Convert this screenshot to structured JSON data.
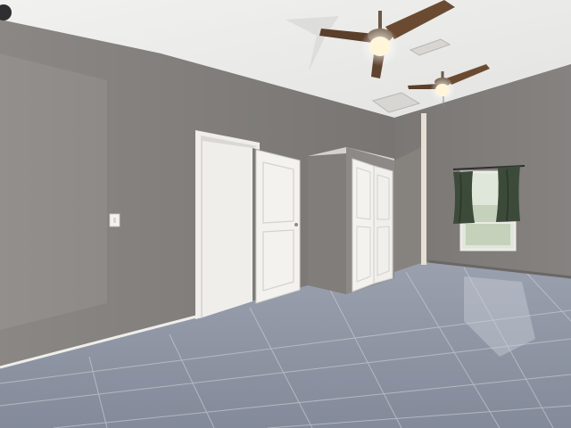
{
  "scene": {
    "description_colors": {
      "ceiling": "#ececea",
      "left_wall": "#7d7a77",
      "back_wall": "#8a8784",
      "right_wall": "#7f7c79",
      "floor": "#8e96a6",
      "trim": "#f2f1ee",
      "door": "#f4f3f0",
      "laundry_wall": "#6b6966",
      "washer": "#2a2d31",
      "window_light": "#dfe6d9",
      "curtain": "#3d4a3b",
      "fan_blade": "#6a4b32",
      "fan_light": "#fff6da"
    }
  }
}
